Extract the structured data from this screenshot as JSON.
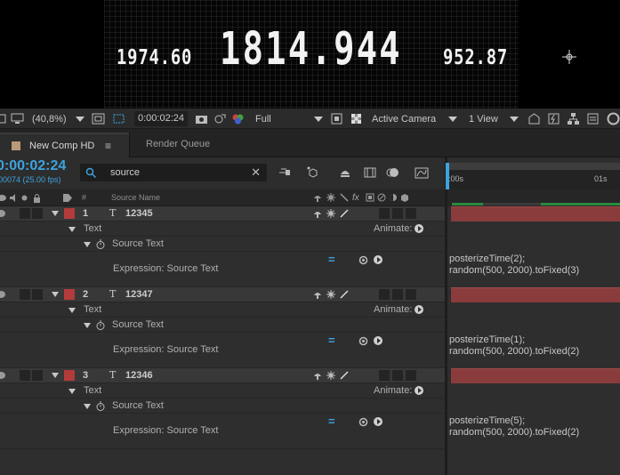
{
  "viewer": {
    "left_number": "1974.60",
    "center_number": "1814.944",
    "right_number": "952.87"
  },
  "toolbar": {
    "zoom": "(40,8%)",
    "timecode": "0:00:02:24",
    "resolution": "Full",
    "camera": "Active Camera",
    "views": "1 View"
  },
  "tabs": {
    "comp": "New Comp HD",
    "comp_menu": "≡",
    "render_queue": "Render Queue"
  },
  "timeline": {
    "timecode": "0:00:02:24",
    "frame_info": "00074 (25.00 fps)",
    "search_value": "source",
    "search_clear": "✕",
    "col_number": "#",
    "col_source_name": "Source Name",
    "ruler_start": "):00s",
    "ruler_mark": "01s"
  },
  "layers": [
    {
      "number": "1",
      "name": "12345",
      "group": "Text",
      "animate": "Animate:",
      "property": "Source Text",
      "expression_label": "Expression: Source Text",
      "expression_line1": "posterizeTime(2);",
      "expression_line2": "random(500, 2000).toFixed(3)"
    },
    {
      "number": "2",
      "name": "12347",
      "group": "Text",
      "animate": "Animate:",
      "property": "Source Text",
      "expression_label": "Expression: Source Text",
      "expression_line1": "posterizeTime(1);",
      "expression_line2": "random(500, 2000).toFixed(2)"
    },
    {
      "number": "3",
      "name": "12346",
      "group": "Text",
      "animate": "Animate:",
      "property": "Source Text",
      "expression_label": "Expression: Source Text",
      "expression_line1": "posterizeTime(5);",
      "expression_line2": "random(500, 2000).toFixed(2)"
    }
  ],
  "colors": {
    "accent": "#3ca4df",
    "label_red": "#b33b3b",
    "layer_bar": "#8a3b3b",
    "work_area": "#2b8a3e"
  }
}
